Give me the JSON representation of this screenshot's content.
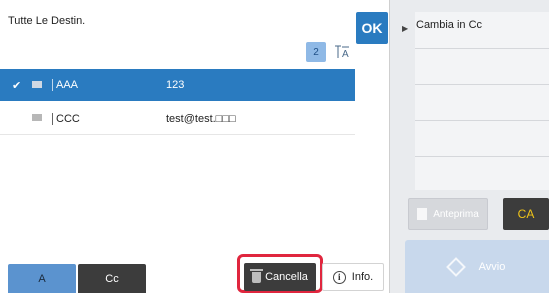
{
  "header": {
    "title": "Tutte Le Destin.",
    "ok_label": "OK",
    "count": "2",
    "sort_icon": "sort-alpha-icon"
  },
  "recipients": [
    {
      "name": "AAA",
      "address": "123",
      "selected": true,
      "icon": "mail-icon"
    },
    {
      "name": "CCC",
      "address": "test@test.□□□",
      "selected": false,
      "icon": "mail-icon"
    }
  ],
  "tabs": [
    {
      "label": "A",
      "active": true
    },
    {
      "label": "Cc",
      "active": false
    }
  ],
  "actions": {
    "delete_label": "Cancella",
    "info_label": "Info."
  },
  "sidebar": {
    "change_cc_label": "Cambia in Cc",
    "preview_label": "Anteprima",
    "ca_label": "CA",
    "start_label": "Avvio"
  },
  "colors": {
    "accent": "#2a7bc0",
    "highlight": "#e0263e",
    "dark_button": "#3c3c3c",
    "ca_text": "#f0c419"
  }
}
